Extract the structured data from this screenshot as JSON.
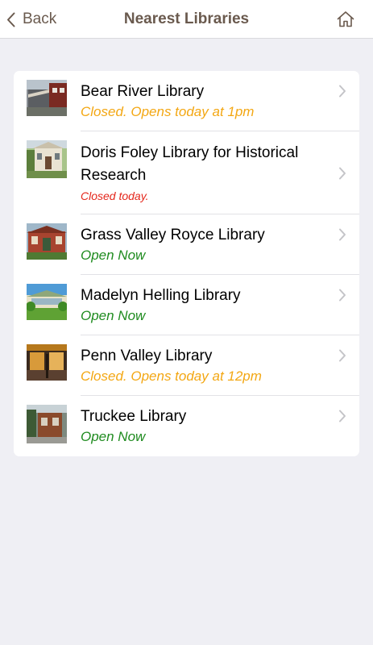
{
  "navbar": {
    "back_label": "Back",
    "title": "Nearest Libraries"
  },
  "colors": {
    "accent": "#6a5a4e",
    "closed_opens": "#f3a713",
    "closed_today": "#e4261b",
    "open_now": "#1f8b1f"
  },
  "libraries": [
    {
      "name": "Bear River Library",
      "status": "Closed. Opens today at 1pm",
      "status_kind": "closed_opens"
    },
    {
      "name": "Doris Foley Library for Historical Research",
      "status": "Closed today.",
      "status_kind": "closed_today"
    },
    {
      "name": "Grass Valley Royce Library",
      "status": "Open Now",
      "status_kind": "open_now"
    },
    {
      "name": "Madelyn Helling Library",
      "status": "Open Now",
      "status_kind": "open_now"
    },
    {
      "name": "Penn Valley Library",
      "status": "Closed. Opens today at 12pm",
      "status_kind": "closed_opens"
    },
    {
      "name": "Truckee Library",
      "status": "Open Now",
      "status_kind": "open_now"
    }
  ]
}
